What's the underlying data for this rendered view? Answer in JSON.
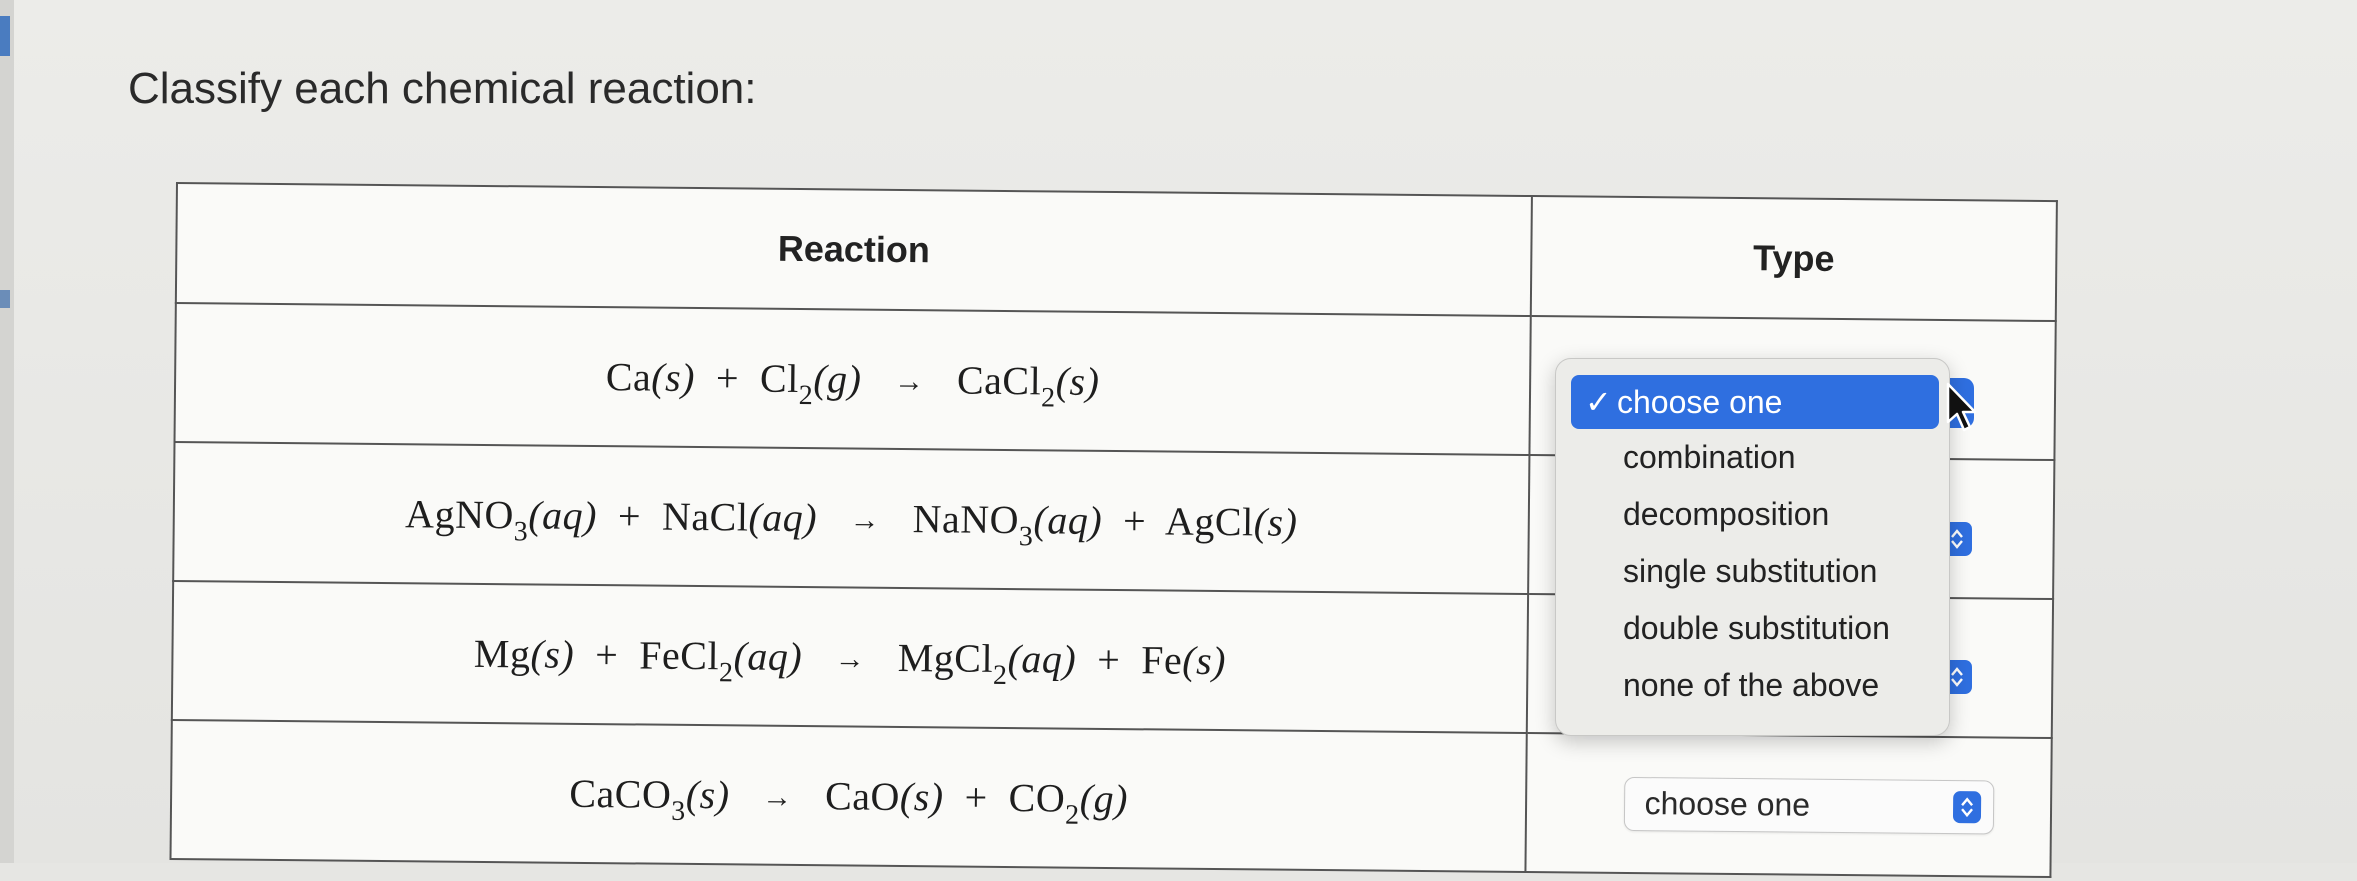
{
  "prompt": "Classify each chemical reaction:",
  "table": {
    "headers": {
      "reaction": "Reaction",
      "type": "Type"
    },
    "rows": [
      {
        "eq": {
          "a1": "Ca",
          "a2": "(s)",
          "a3": "+",
          "a4": "Cl",
          "a4s": "2",
          "a5": "(g)",
          "arrow": "→",
          "b1": "CaCl",
          "b1s": "2",
          "b2": "(s)"
        }
      },
      {
        "eq": {
          "a1": "AgNO",
          "a1s": "3",
          "a2": "(aq)",
          "a3": "+",
          "a4": "NaCl",
          "a5": "(aq)",
          "arrow": "→",
          "b1": "NaNO",
          "b1s": "3",
          "b2": "(aq)",
          "b3": "+",
          "b4": "AgCl",
          "b5": "(s)"
        }
      },
      {
        "eq": {
          "a1": "Mg",
          "a2": "(s)",
          "a3": "+",
          "a4": "FeCl",
          "a4s": "2",
          "a5": "(aq)",
          "arrow": "→",
          "b1": "MgCl",
          "b1s": "2",
          "b2": "(aq)",
          "b3": "+",
          "b4": "Fe",
          "b5": "(s)"
        }
      },
      {
        "eq": {
          "a1": "CaCO",
          "a1s": "3",
          "a2": "(s)",
          "arrow": "→",
          "b1": "CaO",
          "b2": "(s)",
          "b3": "+",
          "b4": "CO",
          "b4s": "2",
          "b5": "(g)"
        },
        "select_value": "choose one"
      }
    ]
  },
  "dropdown": {
    "check": "✓",
    "options": [
      "choose one",
      "combination",
      "decomposition",
      "single substitution",
      "double substitution",
      "none of the above"
    ],
    "selected_index": 0
  },
  "icons": {
    "stepper": "updown-stepper-icon",
    "cursor": "mouse-pointer-icon"
  },
  "colors": {
    "accent": "#2f6fe0"
  }
}
